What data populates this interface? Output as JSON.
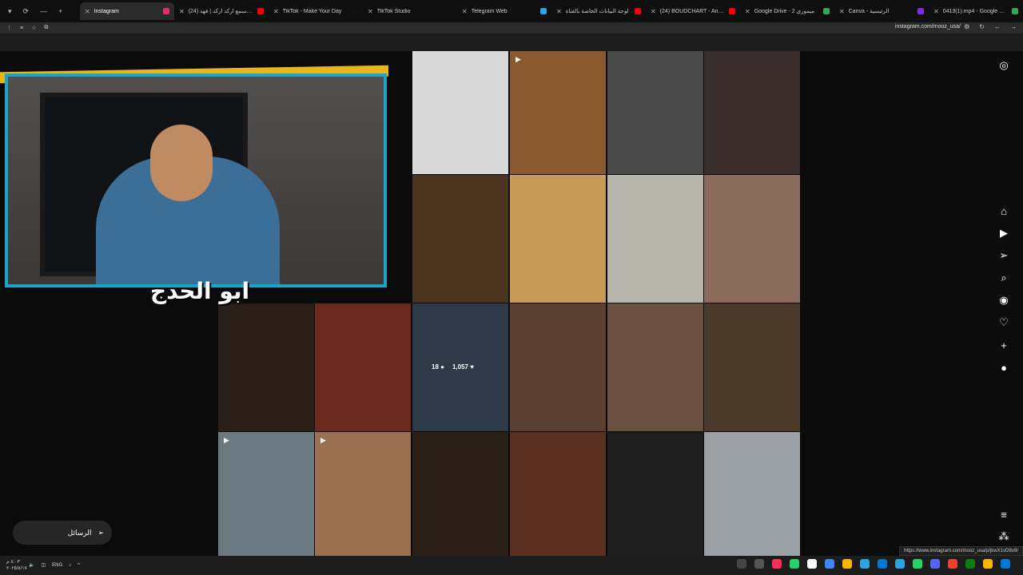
{
  "tabs": [
    {
      "title": "Instagram",
      "active": true,
      "color": "#e1306c"
    },
    {
      "title": "(24) اسمع اسمع اركد اركد | فهد...",
      "active": false,
      "color": "#ff0000"
    },
    {
      "title": "TikTok - Make Your Day",
      "active": false,
      "color": "#111111"
    },
    {
      "title": "TikTok Studio",
      "active": false,
      "color": "#111111"
    },
    {
      "title": "Telegram Web",
      "active": false,
      "color": "#2aa3df"
    },
    {
      "title": "لوحة البيانات الخاصة بالقناة",
      "active": false,
      "color": "#ff0000"
    },
    {
      "title": "(24) BOUDCHART - Ana Baani...",
      "active": false,
      "color": "#ff0000"
    },
    {
      "title": "Google Drive - ميموري 2",
      "active": false,
      "color": "#34a853"
    },
    {
      "title": "Canva - الرئيسية",
      "active": false,
      "color": "#7d2ae8"
    },
    {
      "title": "0413(1).mp4 - Google Drive",
      "active": false,
      "color": "#34a853"
    }
  ],
  "url": "instagram.com/mooz_usa/",
  "grid_stats": {
    "comments": "18",
    "likes": "1,057"
  },
  "messages_label": "الرسائل",
  "cam_logo": "ابو الحدج",
  "status_url": "https://www.instagram.com/mooz_usa/p/jkwX1vD9o9/",
  "taskbar": {
    "time": "٨:٠٣ م",
    "date": "٢٠٢٥/٨/١٧",
    "lang": "ENG"
  },
  "grid_cells": [
    {
      "col": 2,
      "row": 0,
      "color": "#d9d9d9",
      "play": false
    },
    {
      "col": 3,
      "row": 0,
      "color": "#8a5a2e",
      "play": true
    },
    {
      "col": 4,
      "row": 0,
      "color": "#4a4a4a",
      "play": false
    },
    {
      "col": 5,
      "row": 0,
      "color": "#3a2e2a",
      "play": false
    },
    {
      "col": 2,
      "row": 1,
      "color": "#4a3420",
      "play": false
    },
    {
      "col": 3,
      "row": 1,
      "color": "#c79a58",
      "play": false
    },
    {
      "col": 4,
      "row": 1,
      "color": "#b8b5ad",
      "play": false
    },
    {
      "col": 5,
      "row": 1,
      "color": "#8a6a5a",
      "play": false
    },
    {
      "col": 0,
      "row": 2,
      "color": "#2a1f18",
      "play": false
    },
    {
      "col": 1,
      "row": 2,
      "color": "#6a2a1e",
      "play": false
    },
    {
      "col": 2,
      "row": 2,
      "color": "#2f3a48",
      "play": false
    },
    {
      "col": 3,
      "row": 2,
      "color": "#5a4030",
      "play": false
    },
    {
      "col": 4,
      "row": 2,
      "color": "#6a5040",
      "play": false
    },
    {
      "col": 5,
      "row": 2,
      "color": "#4a3a2a",
      "play": false
    },
    {
      "col": 0,
      "row": 3,
      "color": "#6a7a80",
      "play": true
    },
    {
      "col": 1,
      "row": 3,
      "color": "#9a7050",
      "play": true
    },
    {
      "col": 2,
      "row": 3,
      "color": "#2a2018",
      "play": false
    },
    {
      "col": 3,
      "row": 3,
      "color": "#5a3020",
      "play": false
    },
    {
      "col": 4,
      "row": 3,
      "color": "#1e1e1e",
      "play": false
    },
    {
      "col": 5,
      "row": 3,
      "color": "#9aa0a6",
      "play": false
    }
  ]
}
